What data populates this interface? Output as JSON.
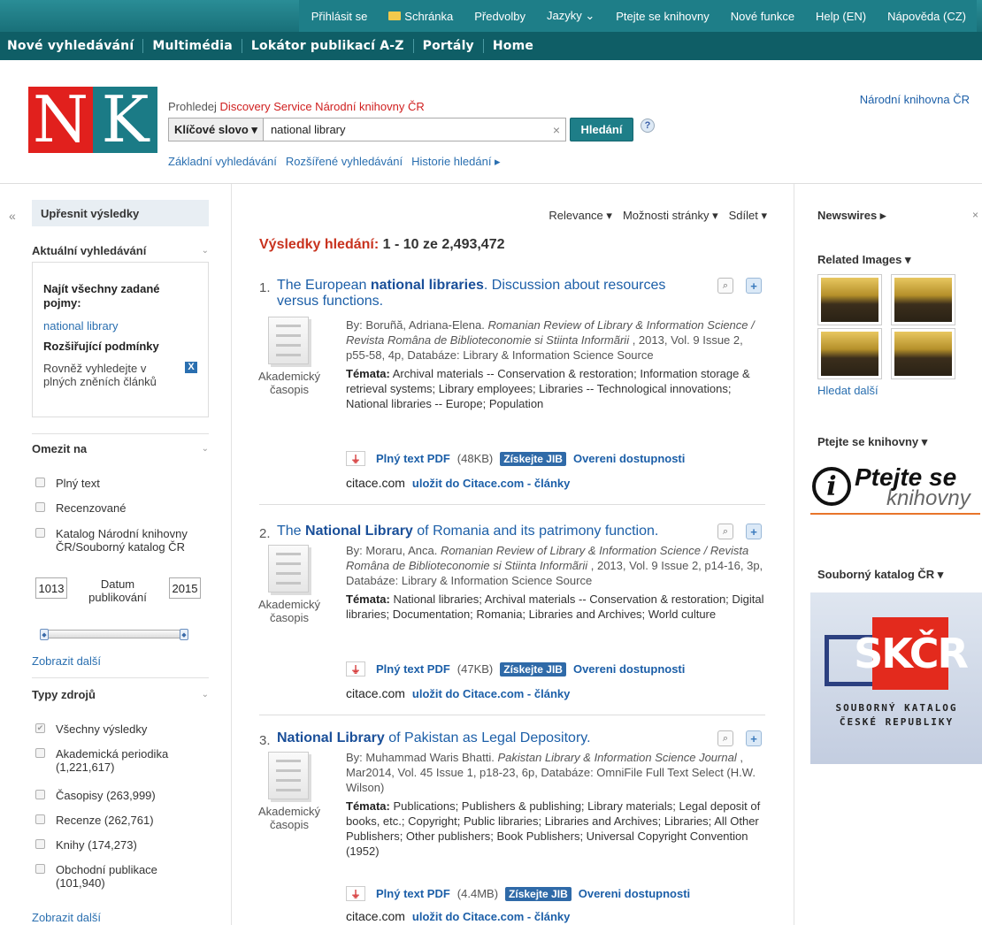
{
  "topnav": {
    "items": [
      "Přihlásit se",
      "Schránka",
      "Předvolby",
      "Jazyky ⌄",
      "Ptejte se knihovny",
      "Nové funkce",
      "Help (EN)",
      "Nápověda (CZ)"
    ]
  },
  "mainnav": {
    "items": [
      "Nové vyhledávání",
      "Multimédia",
      "Lokátor publikací A-Z",
      "Portály",
      "Home"
    ]
  },
  "logo": {
    "n": "N",
    "k": "K"
  },
  "search": {
    "prefix": "Prohledej ",
    "source": "Discovery Service Národní knihovny ČR",
    "field_select": "Klíčové slovo ▾",
    "query": "national library",
    "clear": "×",
    "button": "Hledání",
    "help": "?",
    "basic": "Základní vyhledávání",
    "advanced": "Rozšířené vyhledávání",
    "history": "Historie hledání ▸"
  },
  "institution": "Národní knihovna ČR",
  "left": {
    "collapse": "«",
    "refine": "Upřesnit výsledky",
    "current_search": "Aktuální vyhledávání",
    "chev": "⌄",
    "find_all": "Najít všechny zadané pojmy:",
    "term": "national library",
    "expanders": "Rozšiřující podmínky",
    "fulltext_also": "Rovněž vyhledejte v plných zněních článků",
    "x": "X",
    "limit_to": "Omezit na",
    "limits": [
      "Plný text",
      "Recenzované",
      "Katalog Národní knihovny ČR/Souborný katalog ČR"
    ],
    "date_from": "1013",
    "date_label": "Datum publikování",
    "date_to": "2015",
    "show_more": "Zobrazit další",
    "source_types": "Typy zdrojů",
    "types": [
      {
        "label": "Všechny výsledky",
        "checked": true
      },
      {
        "label": "Akademická periodika (1,221,617)",
        "checked": false
      },
      {
        "label": "Časopisy (263,999)",
        "checked": false
      },
      {
        "label": "Recenze (262,761)",
        "checked": false
      },
      {
        "label": "Knihy (174,273)",
        "checked": false
      },
      {
        "label": "Obchodní publikace (101,940)",
        "checked": false
      }
    ],
    "show_more2": "Zobrazit další"
  },
  "center": {
    "sort": "Relevance ▾",
    "page_options": "Možnosti stránky ▾",
    "share": "Sdílet ▾",
    "results_label": "Výsledky hledání:",
    "results_range": " 1 - 10 ze 2,493,472",
    "results": [
      {
        "num": "1.",
        "title_pre": "The European ",
        "title_bold": "national libraries",
        "title_post": ". Discussion about resources versus functions.",
        "type": "Akademický časopis",
        "by": "By: Boruñă, Adriana-Elena. ",
        "journal": "Romanian Review of Library & Information Science / Revista Româna de Biblioteconomie si Stiinta Informãrii",
        "meta": " , 2013, Vol. 9 Issue 2, p55-58, 4p, Databáze: Library & Information Science Source",
        "subjects_label": "Témata:",
        "subjects": " Archival materials -- Conservation & restoration; Information storage & retrieval systems; Library employees; Libraries -- Technological innovations; National libraries -- Europe; Population",
        "pdf": "Plný text PDF",
        "size": "(48KB)",
        "jib": "Získejte JIB",
        "availability": "Overeni dostupnosti",
        "citace": "citace.com",
        "save": "uložit do Citace.com - články"
      },
      {
        "num": "2.",
        "title_pre": "The ",
        "title_bold": "National Library",
        "title_post": " of Romania and its patrimony function.",
        "type": "Akademický časopis",
        "by": "By: Moraru, Anca. ",
        "journal": "Romanian Review of Library & Information Science / Revista Româna de Biblioteconomie si Stiinta Informãrii",
        "meta": " , 2013, Vol. 9 Issue 2, p14-16, 3p, Databáze: Library & Information Science Source",
        "subjects_label": "Témata:",
        "subjects": " National libraries; Archival materials -- Conservation & restoration; Digital libraries; Documentation; Romania; Libraries and Archives; World culture",
        "pdf": "Plný text PDF",
        "size": "(47KB)",
        "jib": "Získejte JIB",
        "availability": "Overeni dostupnosti",
        "citace": "citace.com",
        "save": "uložit do Citace.com - články"
      },
      {
        "num": "3.",
        "title_pre": "",
        "title_bold": "National Library",
        "title_post": " of Pakistan as Legal Depository.",
        "type": "Akademický časopis",
        "by": "By: Muhammad Waris Bhatti. ",
        "journal": "Pakistan Library & Information Science Journal",
        "meta": " , Mar2014, Vol. 45 Issue 1, p18-23, 6p, Databáze: OmniFile Full Text Select (H.W. Wilson)",
        "subjects_label": "Témata:",
        "subjects": " Publications; Publishers & publishing; Library materials; Legal deposit of books, etc.; Copyright; Public libraries; Libraries and Archives; Libraries; All Other Publishers; Other publishers; Book Publishers; Universal Copyright Convention (1952)",
        "pdf": "Plný text PDF",
        "size": "(4.4MB)",
        "jib": "Získejte JIB",
        "availability": "Overeni dostupnosti",
        "citace": "citace.com",
        "save": "uložit do Citace.com - články"
      }
    ]
  },
  "right": {
    "newswires": "Newswires ▸",
    "close": "×",
    "related_images": "Related Images ▾",
    "search_more": "Hledat další",
    "ask": "Ptejte se knihovny ▾",
    "ask_logo_i": "i",
    "ask_logo_1": "Ptejte se",
    "ask_logo_2": "knihovny",
    "union": "Souborný katalog ČR ▾",
    "skcr": "SKČR",
    "skcr_l1": "SOUBORNÝ KATALOG",
    "skcr_l2": "ČESKÉ REPUBLIKY"
  }
}
